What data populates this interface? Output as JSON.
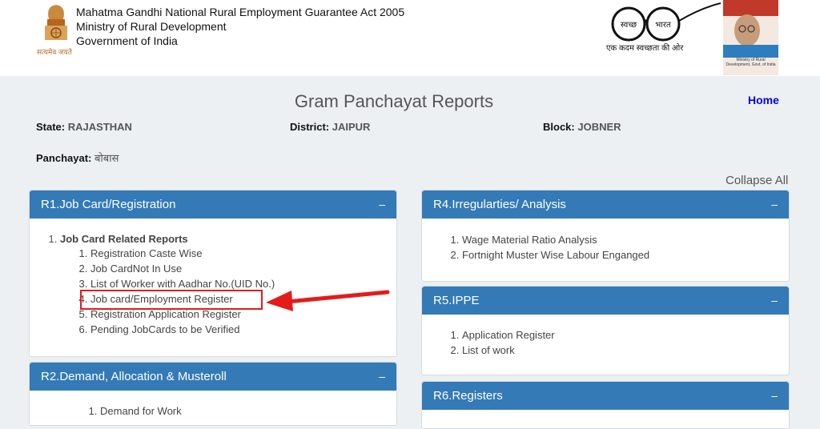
{
  "header": {
    "org_line1": "Mahatma Gandhi National Rural Employment Guarantee Act 2005",
    "org_line2": "Ministry of Rural Development",
    "org_line3": "Government of India",
    "emblem_motto": "सत्यमेव जयते",
    "swachh_word1": "स्वच्छ",
    "swachh_word2": "भारत",
    "swachh_tagline": "एक कदम स्वच्छता की ओर",
    "poster_caption": "Ministry of Rural Development, Govt. of India"
  },
  "page": {
    "title": "Gram Panchayat Reports",
    "home_label": "Home",
    "collapse_all": "Collapse All"
  },
  "meta": {
    "state_label": "State:",
    "state_value": "RAJASTHAN",
    "district_label": "District:",
    "district_value": "JAIPUR",
    "block_label": "Block:",
    "block_value": "JOBNER",
    "panchayat_label": "Panchayat:",
    "panchayat_value": "बोबास"
  },
  "panels": {
    "r1": {
      "title": "R1.Job Card/Registration",
      "toggle": "–",
      "group": "Job Card Related Reports",
      "items": [
        "Registration Caste Wise",
        "Job CardNot In Use",
        "List of Worker with Aadhar No.(UID No.)",
        "Job card/Employment Register",
        "Registration Application Register",
        "Pending JobCards to be Verified"
      ]
    },
    "r2": {
      "title": "R2.Demand, Allocation & Musteroll",
      "toggle": "–",
      "items": [
        "Demand for Work"
      ]
    },
    "r4": {
      "title": "R4.Irregularties/ Analysis",
      "toggle": "–",
      "items": [
        "Wage Material Ratio Analysis",
        "Fortnight Muster Wise Labour Enganged"
      ]
    },
    "r5": {
      "title": "R5.IPPE",
      "toggle": "–",
      "items": [
        "Application Register",
        "List of work"
      ]
    },
    "r6": {
      "title": "R6.Registers",
      "toggle": "–"
    }
  },
  "colors": {
    "panel_header": "#337ab7",
    "highlight": "#e31b1b",
    "link": "#0000ee"
  }
}
